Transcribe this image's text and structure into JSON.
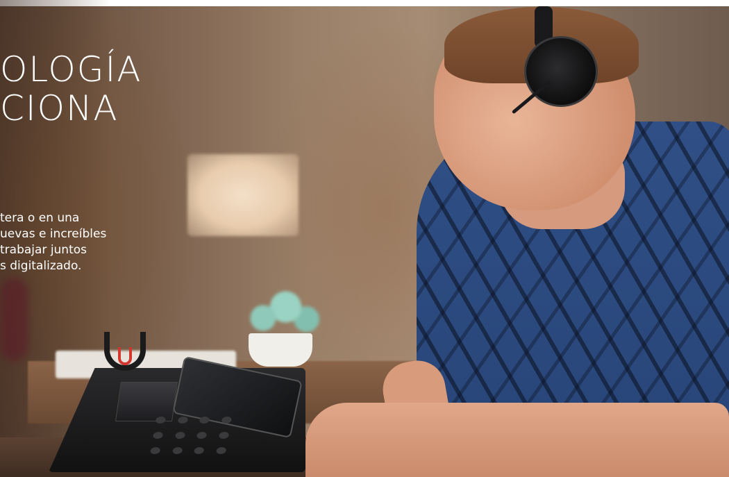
{
  "hero": {
    "headline": "OLOGÍA\nCIONA",
    "body_text": "tera o en una\nuevas e increíbles\ntrabajar juntos\ns digitalizado."
  },
  "colors": {
    "shirt": "#2f4f86",
    "accent_red": "#d1362f",
    "text": "#ffffff"
  },
  "scene": {
    "image_subject": "man-wearing-headset-at-desk-phone"
  }
}
